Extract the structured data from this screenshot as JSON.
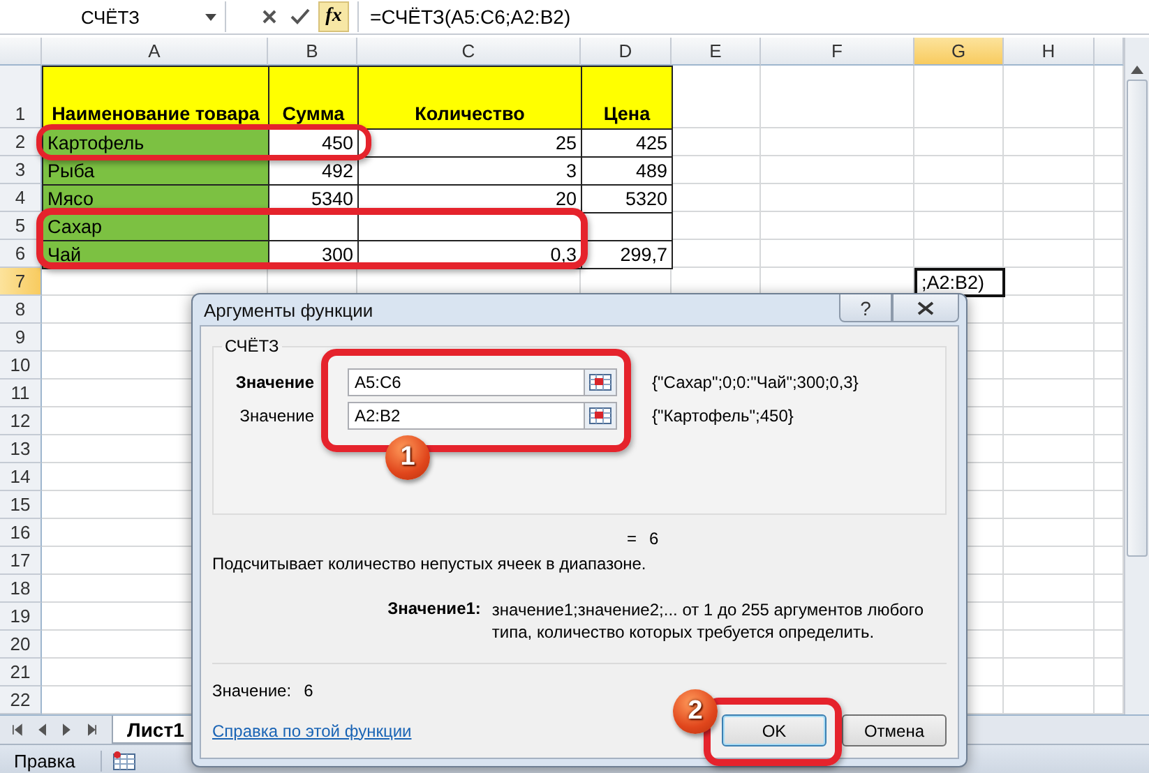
{
  "name_box": "СЧЁТЗ",
  "function_button": "fx",
  "formula": "=СЧЁТЗ(A5:C6;A2:B2)",
  "columns": [
    {
      "label": "A",
      "selected": false
    },
    {
      "label": "B",
      "selected": false
    },
    {
      "label": "C",
      "selected": false
    },
    {
      "label": "D",
      "selected": false
    },
    {
      "label": "E",
      "selected": false
    },
    {
      "label": "F",
      "selected": false
    },
    {
      "label": "G",
      "selected": true
    },
    {
      "label": "H",
      "selected": false
    }
  ],
  "rows": [
    {
      "number": "1",
      "selected": false,
      "cells": [
        {
          "kind": "header",
          "text": "Наименование товара"
        },
        {
          "kind": "header",
          "text": "Сумма"
        },
        {
          "kind": "header",
          "text": "Количество"
        },
        {
          "kind": "header",
          "text": "Цена"
        }
      ]
    },
    {
      "number": "2",
      "selected": false,
      "cells": [
        {
          "kind": "name",
          "text": "Картофель"
        },
        {
          "kind": "number",
          "text": "450"
        },
        {
          "kind": "number",
          "text": "25"
        },
        {
          "kind": "number",
          "text": "425"
        }
      ]
    },
    {
      "number": "3",
      "selected": false,
      "cells": [
        {
          "kind": "name",
          "text": "Рыба"
        },
        {
          "kind": "number",
          "text": "492"
        },
        {
          "kind": "number",
          "text": "3"
        },
        {
          "kind": "number",
          "text": "489"
        }
      ]
    },
    {
      "number": "4",
      "selected": false,
      "cells": [
        {
          "kind": "name",
          "text": "Мясо"
        },
        {
          "kind": "number",
          "text": "5340"
        },
        {
          "kind": "number",
          "text": "20"
        },
        {
          "kind": "number",
          "text": "5320"
        }
      ]
    },
    {
      "number": "5",
      "selected": false,
      "cells": [
        {
          "kind": "name",
          "text": "Сахар"
        },
        {
          "kind": "number"
        },
        {
          "kind": "number"
        },
        {
          "kind": "number"
        }
      ]
    },
    {
      "number": "6",
      "selected": false,
      "cells": [
        {
          "kind": "name",
          "text": "Чай"
        },
        {
          "kind": "number",
          "text": "300"
        },
        {
          "kind": "number",
          "text": "0,3"
        },
        {
          "kind": "number",
          "text": "299,7"
        }
      ]
    },
    {
      "number": "7",
      "selected": true,
      "cells": [
        {
          "kind": "blank"
        },
        {
          "kind": "blank"
        },
        {
          "kind": "blank"
        },
        {
          "kind": "blank"
        },
        {
          "kind": "blank"
        },
        {
          "kind": "blank"
        },
        {
          "kind": "active",
          "text": ";A2:B2)"
        }
      ]
    },
    {
      "number": "8",
      "selected": false
    },
    {
      "number": "9",
      "selected": false
    },
    {
      "number": "10",
      "selected": false
    },
    {
      "number": "11",
      "selected": false
    },
    {
      "number": "12",
      "selected": false
    },
    {
      "number": "13",
      "selected": false
    },
    {
      "number": "14",
      "selected": false
    },
    {
      "number": "15",
      "selected": false
    },
    {
      "number": "16",
      "selected": false
    },
    {
      "number": "17",
      "selected": false
    },
    {
      "number": "18",
      "selected": false
    },
    {
      "number": "19",
      "selected": false
    },
    {
      "number": "20",
      "selected": false
    },
    {
      "number": "21",
      "selected": false
    },
    {
      "number": "22",
      "selected": false
    }
  ],
  "sheet_tabs": [
    {
      "label": "Лист1",
      "selected": true
    }
  ],
  "status": "Правка",
  "dialog": {
    "title": "Аргументы функции",
    "help_button": "?",
    "function_name": "СЧЁТЗ",
    "arguments": [
      {
        "label": "Значение",
        "bold": true,
        "value": "A5:C6",
        "result": "{\"Сахар\";0;0:\"Чай\";300;0,3}"
      },
      {
        "label": "Значение",
        "bold": false,
        "value": "A2:B2",
        "result": "{\"Картофель\";450}"
      }
    ],
    "equals": "=",
    "result": "6",
    "description": "Подсчитывает количество непустых ячеек в диапазоне.",
    "arg_help_label": "Значение1:",
    "arg_help": "значение1;значение2;... от 1 до 255 аргументов любого типа, количество которых требуется определить.",
    "value_label": "Значение:",
    "value": "6",
    "help_link": "Справка по этой функции",
    "buttons": [
      {
        "label": "OK",
        "default": true
      },
      {
        "label": "Отмена",
        "default": false
      }
    ]
  },
  "callouts": [
    {
      "number": "1"
    },
    {
      "number": "2"
    }
  ]
}
